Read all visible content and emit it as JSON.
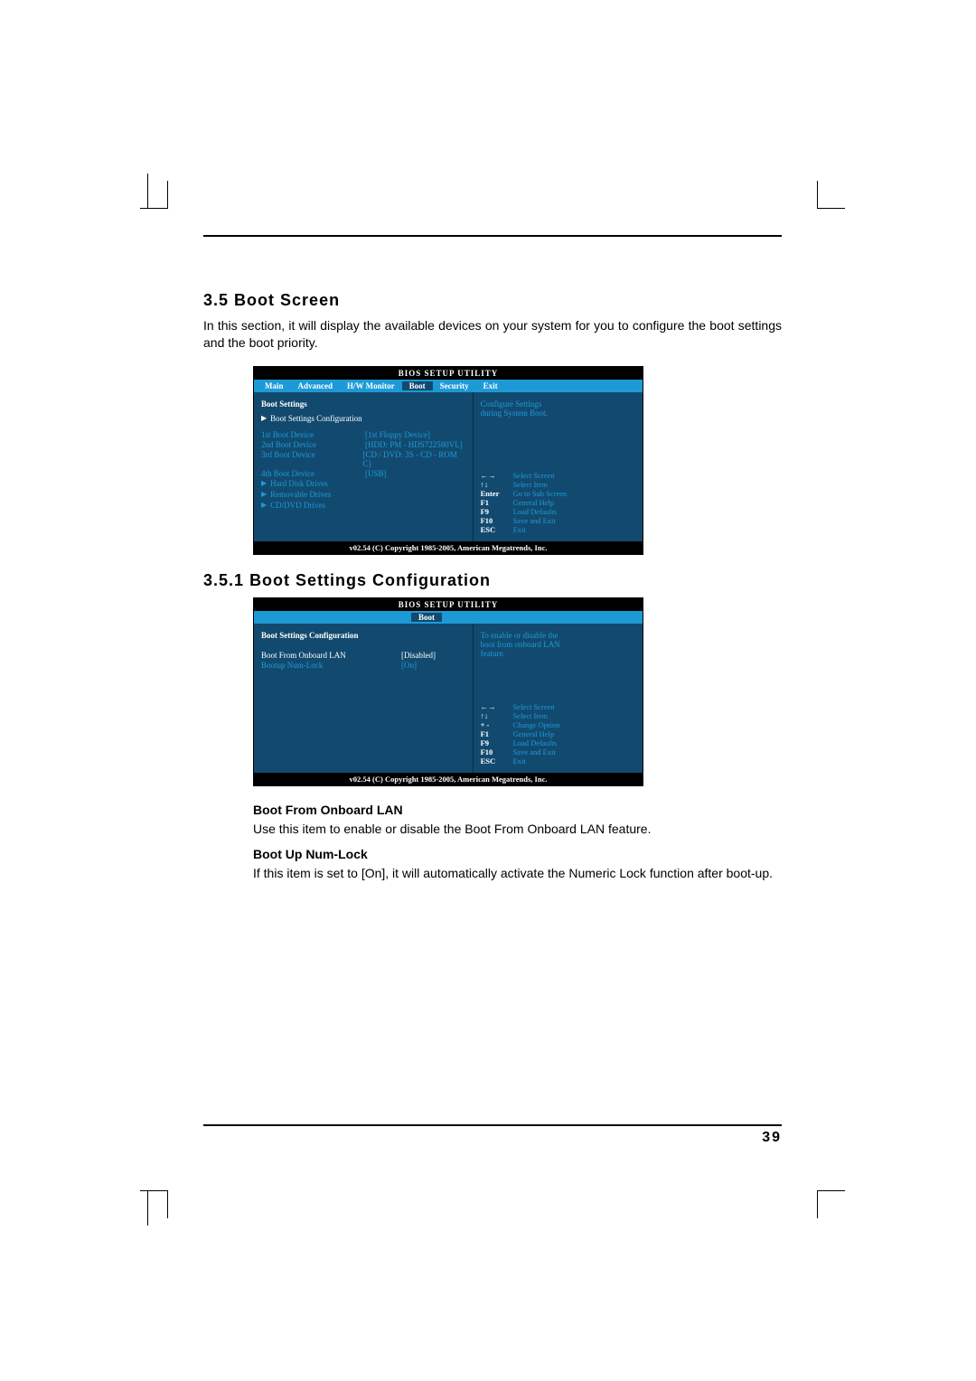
{
  "page_number": "39",
  "section": {
    "num": "3.5",
    "title": "Boot Screen",
    "intro": "In this section, it will display the available devices on your system for you to configure the boot settings and the boot priority."
  },
  "subsection": {
    "num": "3.5.1",
    "title": "Boot Settings Configuration"
  },
  "bios_title": "BIOS  SETUP  UTILITY",
  "bios_copyright": "v02.54 (C) Copyright 1985-2005, American Megatrends, Inc.",
  "menu": {
    "main": "Main",
    "advanced": "Advanced",
    "hwmonitor": "H/W Monitor",
    "boot": "Boot",
    "security": "Security",
    "exit": "Exit"
  },
  "boot_screen": {
    "header": "Boot Settings",
    "submenu_config": "Boot Settings Configuration",
    "devices": [
      {
        "k": "1st Boot Device",
        "v": "[1st  Floppy Device]"
      },
      {
        "k": "2nd Boot Device",
        "v": "[HDD: PM - HDS722580VL]"
      },
      {
        "k": "3rd Boot Device",
        "v": "[CD / DVD: 3S - CD - ROM C]"
      },
      {
        "k": "4th Boot Device",
        "v": "[USB]"
      }
    ],
    "subs": [
      "Hard Disk Drives",
      "Removable Drives",
      "CD/DVD Drives"
    ],
    "help_desc_l1": "Configure Settings",
    "help_desc_l2": "during System Boot.",
    "keys": [
      {
        "k": "←→",
        "d": "Select Screen"
      },
      {
        "k": "↑↓",
        "d": "Select Item"
      },
      {
        "k": "Enter",
        "d": "Go to Sub Screen"
      },
      {
        "k": "F1",
        "d": "General Help"
      },
      {
        "k": "F9",
        "d": "Load Defaults"
      },
      {
        "k": "F10",
        "d": "Save and Exit"
      },
      {
        "k": "ESC",
        "d": "Exit"
      }
    ]
  },
  "boot_config": {
    "header": "Boot Settings Configuration",
    "rows": [
      {
        "k": "Boot From Onboard LAN",
        "v": "[Disabled]"
      },
      {
        "k": "Bootup Num-Lock",
        "v": "[On]"
      }
    ],
    "help_desc_l1": "To enable or disable the",
    "help_desc_l2": "boot from onboard LAN",
    "help_desc_l3": "feature.",
    "keys": [
      {
        "k": "←→",
        "d": "Select Screen"
      },
      {
        "k": "↑↓",
        "d": "Select Item"
      },
      {
        "k": "+ -",
        "d": "Change Option"
      },
      {
        "k": "F1",
        "d": "General Help"
      },
      {
        "k": "F9",
        "d": "Load Defaults"
      },
      {
        "k": "F10",
        "d": "Save and Exit"
      },
      {
        "k": "ESC",
        "d": "Exit"
      }
    ]
  },
  "definitions": {
    "d1_title": "Boot From Onboard LAN",
    "d1_body": "Use this item to enable or disable the Boot From Onboard LAN feature.",
    "d2_title": "Boot Up Num-Lock",
    "d2_body": "If this item is set to [On], it will automatically activate the Numeric Lock function after boot-up."
  }
}
